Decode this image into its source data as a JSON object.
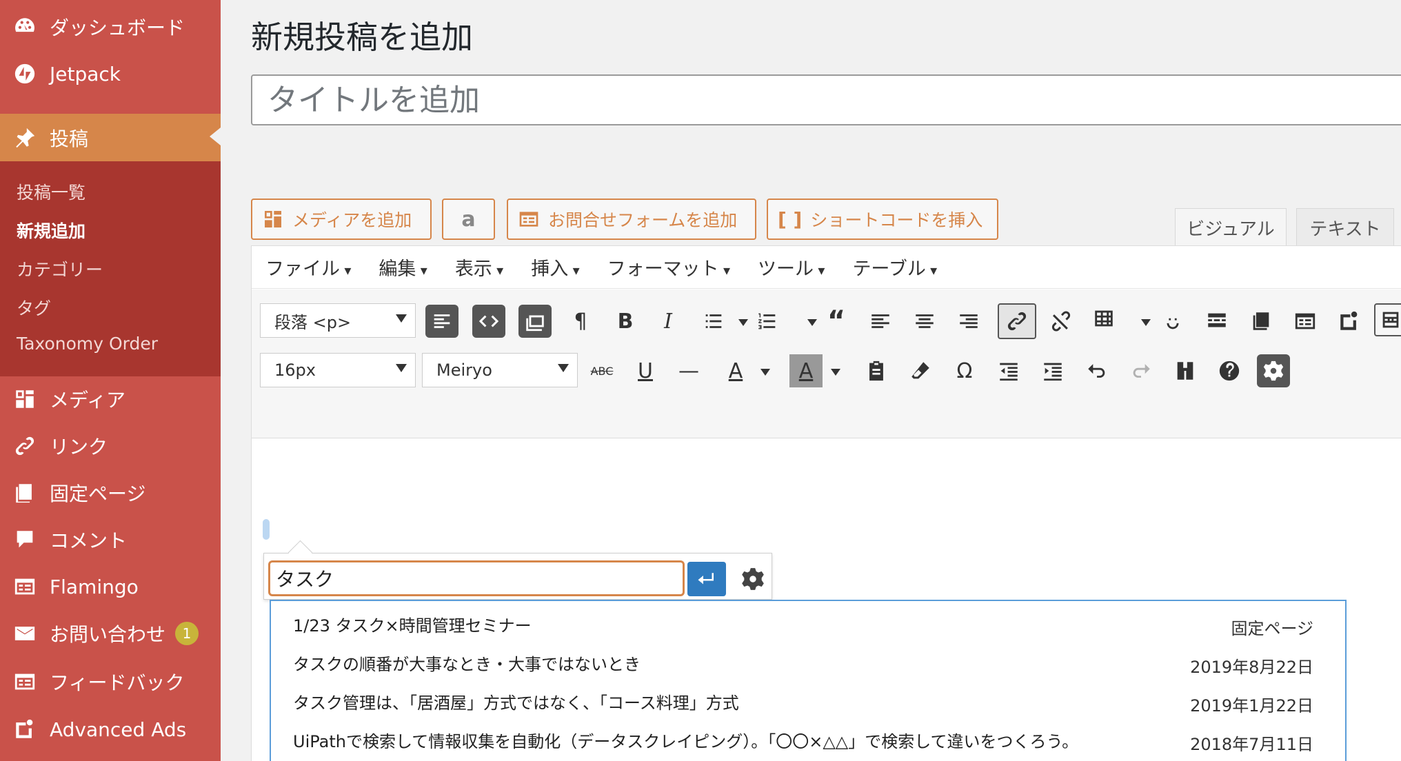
{
  "sidebar": {
    "top_items": [
      {
        "label": "ダッシュボード",
        "icon": "dashboard-icon"
      },
      {
        "label": "Jetpack",
        "icon": "jetpack-icon"
      },
      {
        "label": "投稿",
        "icon": "pin-icon"
      }
    ],
    "sub_items": [
      "投稿一覧",
      "新規追加",
      "カテゴリー",
      "タグ",
      "Taxonomy Order"
    ],
    "bottom_items": [
      {
        "label": "メディア",
        "icon": "media-icon"
      },
      {
        "label": "リンク",
        "icon": "link-icon"
      },
      {
        "label": "固定ページ",
        "icon": "pages-icon"
      },
      {
        "label": "コメント",
        "icon": "comment-icon"
      },
      {
        "label": "Flamingo",
        "icon": "flamingo-icon"
      },
      {
        "label": "お問い合わせ",
        "icon": "mail-icon",
        "badge": "1"
      },
      {
        "label": "フィードバック",
        "icon": "feedback-icon"
      },
      {
        "label": "Advanced Ads",
        "icon": "ads-icon"
      }
    ]
  },
  "main": {
    "title": "新規投稿を追加",
    "title_placeholder": "タイトルを追加",
    "media_buttons": [
      "メディアを追加",
      "a",
      "お問合せフォームを追加",
      "ショートコードを挿入"
    ],
    "tabs": [
      "ビジュアル",
      "テキスト"
    ]
  },
  "editor": {
    "menubar": [
      "ファイル",
      "編集",
      "表示",
      "挿入",
      "フォーマット",
      "ツール",
      "テーブル"
    ],
    "format_select": "段落 <p>",
    "size_select": "16px",
    "font_select": "Meiryo"
  },
  "link_popup": {
    "input_value": "タスク",
    "suggestions": [
      {
        "title": "1/23 タスク×時間管理セミナー",
        "meta": "固定ページ"
      },
      {
        "title": "タスクの順番が大事なとき・大事ではないとき",
        "meta": "2019年8月22日"
      },
      {
        "title": "タスク管理は、「居酒屋」方式ではなく、「コース料理」方式",
        "meta": "2019年1月22日"
      },
      {
        "title": "UiPathで検索して情報収集を自動化（データスクレイピング）。「〇〇×△△」で検索して違いをつくろう。",
        "meta": "2018年7月11日"
      }
    ]
  },
  "colors": {
    "sidebar": "#c9524a",
    "sidebar_active": "#d6864a",
    "submenu": "#a8362f",
    "accent": "#d6864a",
    "link_blue": "#2f7bbf"
  }
}
